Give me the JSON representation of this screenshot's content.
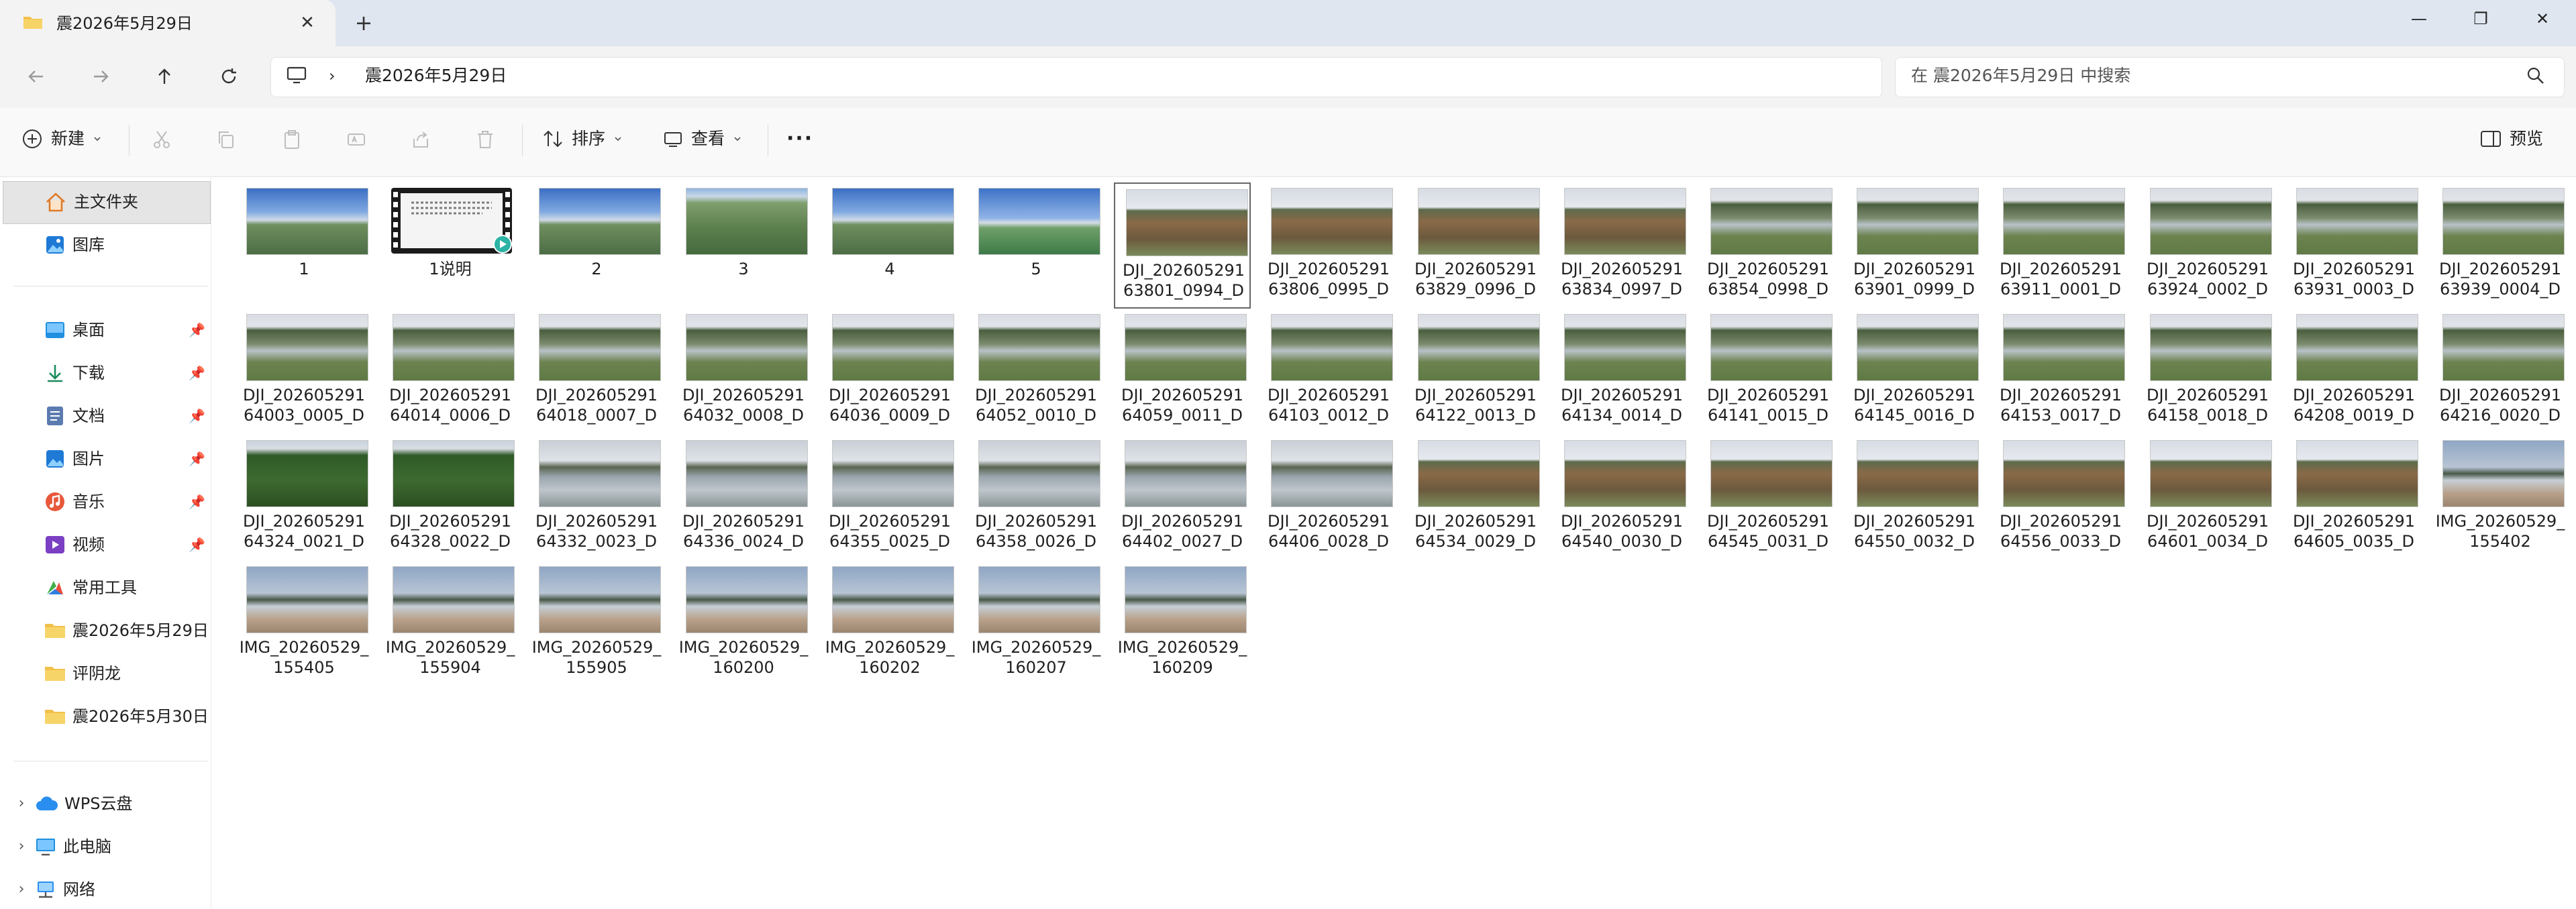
{
  "window": {
    "tab_title": "震2026年5月29日",
    "close_tab_glyph": "✕",
    "new_tab_glyph": "+",
    "minimize_glyph": "—",
    "maximize_glyph": "❐",
    "close_glyph": "✕"
  },
  "address": {
    "path": "震2026年5月29日",
    "separator": "›",
    "search_placeholder": "在 震2026年5月29日 中搜索"
  },
  "toolbar": {
    "new_label": "新建",
    "sort_label": "排序",
    "view_label": "查看",
    "more_glyph": "···",
    "preview_label": "预览"
  },
  "sidebar": {
    "home": "主文件夹",
    "gallery": "图库",
    "desktop": "桌面",
    "downloads": "下载",
    "documents": "文档",
    "pictures": "图片",
    "music": "音乐",
    "videos": "视频",
    "tools": "常用工具",
    "folder1": "震2026年5月29日",
    "folder2": "评阴龙",
    "folder3": "震2026年5月30日",
    "wps": "WPS云盘",
    "this_pc": "此电脑",
    "network": "网络",
    "pin_glyph": "📌",
    "expand_glyph": "›"
  },
  "files": [
    {
      "l1": "1",
      "l2": "",
      "kind": "sky"
    },
    {
      "l1": "1说明",
      "l2": "",
      "kind": "video"
    },
    {
      "l1": "2",
      "l2": "",
      "kind": "sky"
    },
    {
      "l1": "3",
      "l2": "",
      "kind": "terrain"
    },
    {
      "l1": "4",
      "l2": "",
      "kind": "sky"
    },
    {
      "l1": "5",
      "l2": "",
      "kind": "sky2"
    },
    {
      "l1": "DJI_202605291",
      "l2": "63801_0994_D",
      "kind": "field"
    },
    {
      "l1": "DJI_202605291",
      "l2": "63806_0995_D",
      "kind": "field"
    },
    {
      "l1": "DJI_202605291",
      "l2": "63829_0996_D",
      "kind": "field"
    },
    {
      "l1": "DJI_202605291",
      "l2": "63834_0997_D",
      "kind": "field"
    },
    {
      "l1": "DJI_202605291",
      "l2": "63854_0998_D",
      "kind": "river"
    },
    {
      "l1": "DJI_202605291",
      "l2": "63901_0999_D",
      "kind": "river"
    },
    {
      "l1": "DJI_202605291",
      "l2": "63911_0001_D",
      "kind": "river"
    },
    {
      "l1": "DJI_202605291",
      "l2": "63924_0002_D",
      "kind": "river"
    },
    {
      "l1": "DJI_202605291",
      "l2": "63931_0003_D",
      "kind": "river"
    },
    {
      "l1": "DJI_202605291",
      "l2": "63939_0004_D",
      "kind": "river"
    },
    {
      "l1": "DJI_202605291",
      "l2": "64003_0005_D",
      "kind": "river"
    },
    {
      "l1": "DJI_202605291",
      "l2": "64014_0006_D",
      "kind": "river"
    },
    {
      "l1": "DJI_202605291",
      "l2": "64018_0007_D",
      "kind": "river"
    },
    {
      "l1": "DJI_202605291",
      "l2": "64032_0008_D",
      "kind": "river"
    },
    {
      "l1": "DJI_202605291",
      "l2": "64036_0009_D",
      "kind": "river"
    },
    {
      "l1": "DJI_202605291",
      "l2": "64052_0010_D",
      "kind": "river"
    },
    {
      "l1": "DJI_202605291",
      "l2": "64059_0011_D",
      "kind": "river"
    },
    {
      "l1": "DJI_202605291",
      "l2": "64103_0012_D",
      "kind": "river"
    },
    {
      "l1": "DJI_202605291",
      "l2": "64122_0013_D",
      "kind": "river"
    },
    {
      "l1": "DJI_202605291",
      "l2": "64134_0014_D",
      "kind": "river"
    },
    {
      "l1": "DJI_202605291",
      "l2": "64141_0015_D",
      "kind": "river"
    },
    {
      "l1": "DJI_202605291",
      "l2": "64145_0016_D",
      "kind": "river"
    },
    {
      "l1": "DJI_202605291",
      "l2": "64153_0017_D",
      "kind": "river"
    },
    {
      "l1": "DJI_202605291",
      "l2": "64158_0018_D",
      "kind": "river"
    },
    {
      "l1": "DJI_202605291",
      "l2": "64208_0019_D",
      "kind": "river"
    },
    {
      "l1": "DJI_202605291",
      "l2": "64216_0020_D",
      "kind": "river"
    },
    {
      "l1": "DJI_202605291",
      "l2": "64324_0021_D",
      "kind": "forest"
    },
    {
      "l1": "DJI_202605291",
      "l2": "64328_0022_D",
      "kind": "forest"
    },
    {
      "l1": "DJI_202605291",
      "l2": "64332_0023_D",
      "kind": "lake"
    },
    {
      "l1": "DJI_202605291",
      "l2": "64336_0024_D",
      "kind": "lake"
    },
    {
      "l1": "DJI_202605291",
      "l2": "64355_0025_D",
      "kind": "lake"
    },
    {
      "l1": "DJI_202605291",
      "l2": "64358_0026_D",
      "kind": "lake"
    },
    {
      "l1": "DJI_202605291",
      "l2": "64402_0027_D",
      "kind": "lake"
    },
    {
      "l1": "DJI_202605291",
      "l2": "64406_0028_D",
      "kind": "lake"
    },
    {
      "l1": "DJI_202605291",
      "l2": "64534_0029_D",
      "kind": "field"
    },
    {
      "l1": "DJI_202605291",
      "l2": "64540_0030_D",
      "kind": "field"
    },
    {
      "l1": "DJI_202605291",
      "l2": "64545_0031_D",
      "kind": "field"
    },
    {
      "l1": "DJI_202605291",
      "l2": "64550_0032_D",
      "kind": "field"
    },
    {
      "l1": "DJI_202605291",
      "l2": "64556_0033_D",
      "kind": "field"
    },
    {
      "l1": "DJI_202605291",
      "l2": "64601_0034_D",
      "kind": "field"
    },
    {
      "l1": "DJI_202605291",
      "l2": "64605_0035_D",
      "kind": "field"
    },
    {
      "l1": "IMG_20260529_",
      "l2": "155402",
      "kind": "shore"
    },
    {
      "l1": "IMG_20260529_",
      "l2": "155405",
      "kind": "shore"
    },
    {
      "l1": "IMG_20260529_",
      "l2": "155904",
      "kind": "shore"
    },
    {
      "l1": "IMG_20260529_",
      "l2": "155905",
      "kind": "shore"
    },
    {
      "l1": "IMG_20260529_",
      "l2": "160200",
      "kind": "shore"
    },
    {
      "l1": "IMG_20260529_",
      "l2": "160202",
      "kind": "shore"
    },
    {
      "l1": "IMG_20260529_",
      "l2": "160207",
      "kind": "shore"
    },
    {
      "l1": "IMG_20260529_",
      "l2": "160209",
      "kind": "shore"
    }
  ],
  "selected_index": 6,
  "colors": {
    "titlebar": "#dfe6f0",
    "accent": "#0067c0",
    "folder": "#f2c04a"
  }
}
